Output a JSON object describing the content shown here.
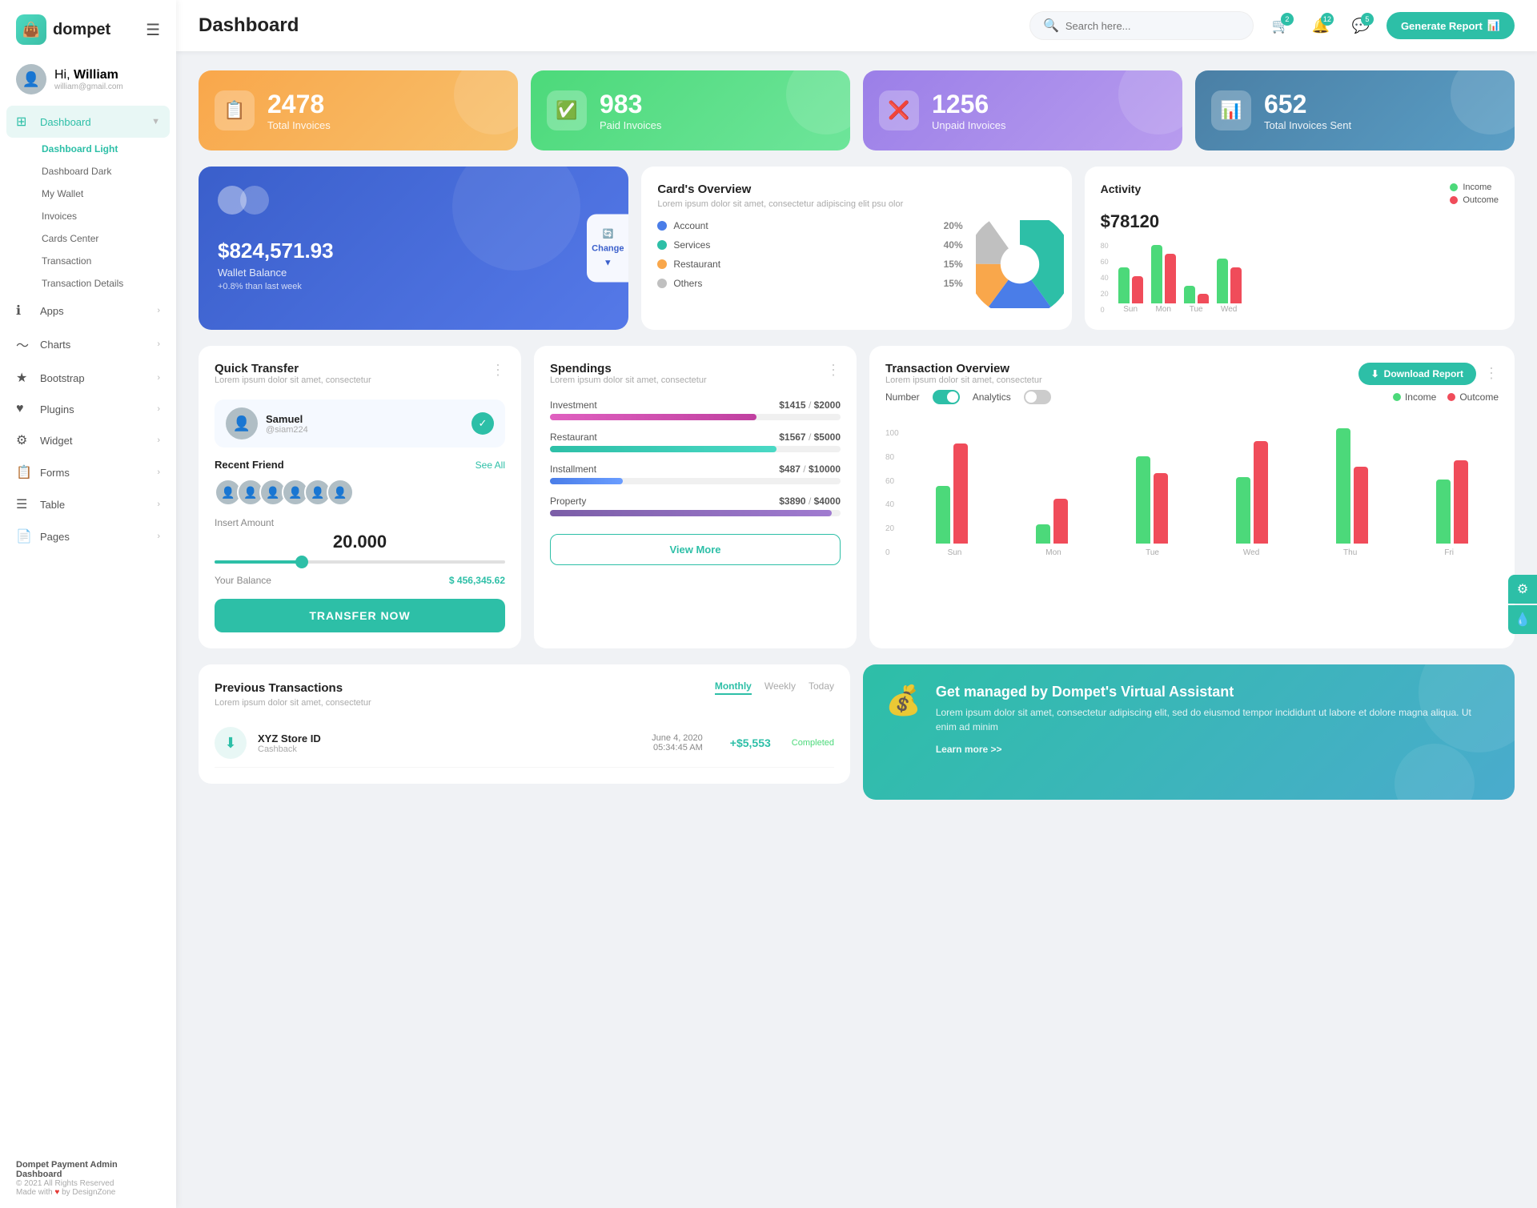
{
  "app": {
    "name": "dompet",
    "logo_emoji": "👜"
  },
  "header": {
    "title": "Dashboard",
    "search_placeholder": "Search here...",
    "generate_btn": "Generate Report",
    "notif_badges": {
      "cart": "2",
      "bell": "12",
      "chat": "5"
    }
  },
  "sidebar": {
    "user": {
      "greeting": "Hi,",
      "name": "William",
      "email": "william@gmail.com"
    },
    "nav_main": [
      {
        "id": "dashboard",
        "label": "Dashboard",
        "icon": "⊞",
        "active": true,
        "has_badge": false
      },
      {
        "id": "apps",
        "label": "Apps",
        "icon": "ℹ",
        "has_chevron": true
      },
      {
        "id": "charts",
        "label": "Charts",
        "icon": "〜",
        "has_chevron": true
      },
      {
        "id": "bootstrap",
        "label": "Bootstrap",
        "icon": "★",
        "has_chevron": true
      },
      {
        "id": "plugins",
        "label": "Plugins",
        "icon": "♥",
        "has_chevron": true
      },
      {
        "id": "widget",
        "label": "Widget",
        "icon": "⚙",
        "has_chevron": true
      },
      {
        "id": "forms",
        "label": "Forms",
        "icon": "📋",
        "has_chevron": true
      },
      {
        "id": "table",
        "label": "Table",
        "icon": "☰",
        "has_chevron": true
      },
      {
        "id": "pages",
        "label": "Pages",
        "icon": "📄",
        "has_chevron": true
      }
    ],
    "sub_nav": [
      {
        "label": "Dashboard Light",
        "active": true
      },
      {
        "label": "Dashboard Dark",
        "active": false
      },
      {
        "label": "My Wallet",
        "active": false
      },
      {
        "label": "Invoices",
        "active": false
      },
      {
        "label": "Cards Center",
        "active": false
      },
      {
        "label": "Transaction",
        "active": false
      },
      {
        "label": "Transaction Details",
        "active": false
      }
    ],
    "footer": {
      "title": "Dompet Payment Admin Dashboard",
      "copy": "© 2021 All Rights Reserved",
      "made_with": "Made with",
      "by": "by DesignZone"
    }
  },
  "stats": [
    {
      "id": "total-invoices",
      "number": "2478",
      "label": "Total Invoices",
      "color": "orange",
      "icon": "📋"
    },
    {
      "id": "paid-invoices",
      "number": "983",
      "label": "Paid Invoices",
      "color": "green",
      "icon": "✓"
    },
    {
      "id": "unpaid-invoices",
      "number": "1256",
      "label": "Unpaid Invoices",
      "color": "purple",
      "icon": "✗"
    },
    {
      "id": "total-sent",
      "number": "652",
      "label": "Total Invoices Sent",
      "color": "teal",
      "icon": "📊"
    }
  ],
  "wallet": {
    "amount": "$824,571.93",
    "label": "Wallet Balance",
    "change": "+0.8% than last week",
    "change_btn": "Change"
  },
  "cards_overview": {
    "title": "Card's Overview",
    "subtitle": "Lorem ipsum dolor sit amet, consectetur adipiscing elit psu olor",
    "items": [
      {
        "label": "Account",
        "pct": "20%",
        "dot": "blue"
      },
      {
        "label": "Services",
        "pct": "40%",
        "dot": "teal"
      },
      {
        "label": "Restaurant",
        "pct": "15%",
        "dot": "orange"
      },
      {
        "label": "Others",
        "pct": "15%",
        "dot": "gray"
      }
    ]
  },
  "activity": {
    "title": "Activity",
    "amount": "$78120",
    "legend": [
      {
        "label": "Income",
        "color": "green"
      },
      {
        "label": "Outcome",
        "color": "red"
      }
    ],
    "bars": [
      {
        "day": "Sun",
        "income": 40,
        "outcome": 30
      },
      {
        "day": "Mon",
        "income": 65,
        "outcome": 55
      },
      {
        "day": "Tue",
        "income": 20,
        "outcome": 10
      },
      {
        "day": "Wed",
        "income": 50,
        "outcome": 40
      }
    ],
    "y_labels": [
      "80",
      "60",
      "40",
      "20",
      "0"
    ]
  },
  "quick_transfer": {
    "title": "Quick Transfer",
    "subtitle": "Lorem ipsum dolor sit amet, consectetur",
    "contact": {
      "name": "Samuel",
      "handle": "@siam224"
    },
    "recent_label": "Recent Friend",
    "see_more": "See All",
    "amount_label": "Insert Amount",
    "amount": "20.000",
    "balance_label": "Your Balance",
    "balance": "$ 456,345.62",
    "transfer_btn": "TRANSFER NOW"
  },
  "spendings": {
    "title": "Spendings",
    "subtitle": "Lorem ipsum dolor sit amet, consectetur",
    "items": [
      {
        "label": "Investment",
        "spent": "$1415",
        "total": "$2000",
        "fill_class": "fill-pink",
        "width": "71"
      },
      {
        "label": "Restaurant",
        "spent": "$1567",
        "total": "$5000",
        "fill_class": "fill-teal",
        "width": "31"
      },
      {
        "label": "Installment",
        "spent": "$487",
        "total": "$10000",
        "fill_class": "fill-blue",
        "width": "25"
      },
      {
        "label": "Property",
        "spent": "$3890",
        "total": "$4000",
        "fill_class": "fill-purple",
        "width": "97"
      }
    ],
    "view_more_btn": "View More"
  },
  "transaction_overview": {
    "title": "Transaction Overview",
    "subtitle": "Lorem ipsum dolor sit amet, consectetur",
    "download_btn": "Download Report",
    "toggles": [
      {
        "label": "Number",
        "state": "on"
      },
      {
        "label": "Analytics",
        "state": "off"
      }
    ],
    "legend": [
      {
        "label": "Income",
        "color": "green"
      },
      {
        "label": "Outcome",
        "color": "red"
      }
    ],
    "bars": [
      {
        "day": "Sun",
        "income": 45,
        "outcome": 78
      },
      {
        "day": "Mon",
        "income": 15,
        "outcome": 35
      },
      {
        "day": "Tue",
        "income": 68,
        "outcome": 55
      },
      {
        "day": "Wed",
        "income": 52,
        "outcome": 80
      },
      {
        "day": "Thu",
        "income": 90,
        "outcome": 60
      },
      {
        "day": "Fri",
        "income": 50,
        "outcome": 65
      }
    ],
    "y_labels": [
      "100",
      "80",
      "60",
      "40",
      "20",
      "0"
    ]
  },
  "previous_transactions": {
    "title": "Previous Transactions",
    "subtitle": "Lorem ipsum dolor sit amet, consectetur",
    "tabs": [
      "Monthly",
      "Weekly",
      "Today"
    ],
    "active_tab": "Monthly",
    "items": [
      {
        "id": "xyz-store",
        "name": "XYZ Store ID",
        "type": "Cashback",
        "date": "June 4, 2020",
        "time": "05:34:45 AM",
        "amount": "+$5,553",
        "status": "Completed",
        "icon": "⬇"
      }
    ]
  },
  "va_banner": {
    "title": "Get managed by Dompet's Virtual Assistant",
    "desc": "Lorem ipsum dolor sit amet, consectetur adipiscing elit, sed do eiusmod tempor incididunt ut labore et dolore magna aliqua. Ut enim ad minim",
    "link": "Learn more >>"
  }
}
